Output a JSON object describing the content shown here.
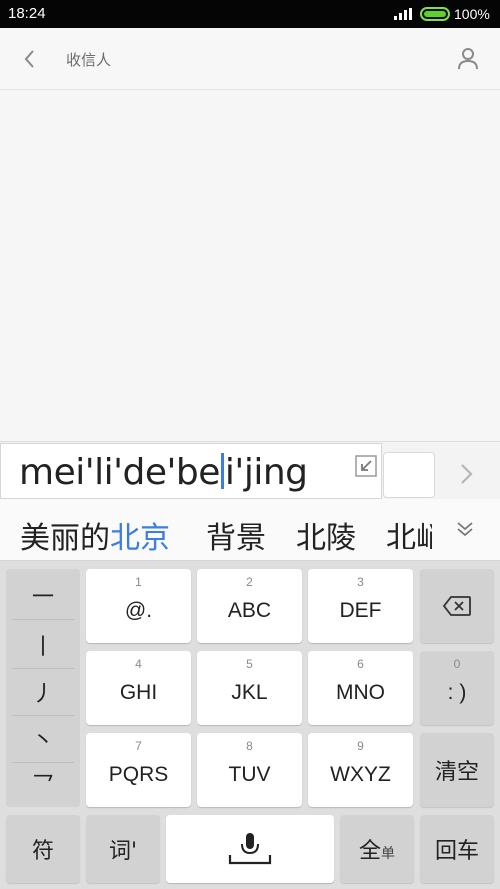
{
  "status": {
    "time": "18:24",
    "battery": "100%",
    "battery_level": 1.0
  },
  "header": {
    "title": "收信人",
    "back_icon": "chevron-left-icon",
    "contact_icon": "person-icon"
  },
  "ime": {
    "composition_before": "mei'li'de'be",
    "composition_after": "i'jing",
    "candidates": [
      {
        "prefix": "美丽的",
        "highlight": "北京"
      },
      {
        "prefix": "背景",
        "highlight": ""
      },
      {
        "prefix": "北陵",
        "highlight": ""
      }
    ],
    "partial_candidate": "北峭",
    "accent": "#3b7de0"
  },
  "keyboard": {
    "punctuation": [
      "一",
      "丨",
      "丿",
      "丶",
      "乛"
    ],
    "keys": [
      {
        "num": "1",
        "label": "@."
      },
      {
        "num": "2",
        "label": "ABC"
      },
      {
        "num": "3",
        "label": "DEF"
      },
      {
        "num": "4",
        "label": "GHI"
      },
      {
        "num": "5",
        "label": "JKL"
      },
      {
        "num": "6",
        "label": "MNO"
      },
      {
        "num": "7",
        "label": "PQRS"
      },
      {
        "num": "8",
        "label": "TUV"
      },
      {
        "num": "9",
        "label": "WXYZ"
      }
    ],
    "zero_key": {
      "num": "0",
      "label": ": )"
    },
    "clear": "清空",
    "symbol": "符",
    "word": "词'",
    "full_main": "全",
    "full_sub": "单",
    "enter": "回车"
  }
}
